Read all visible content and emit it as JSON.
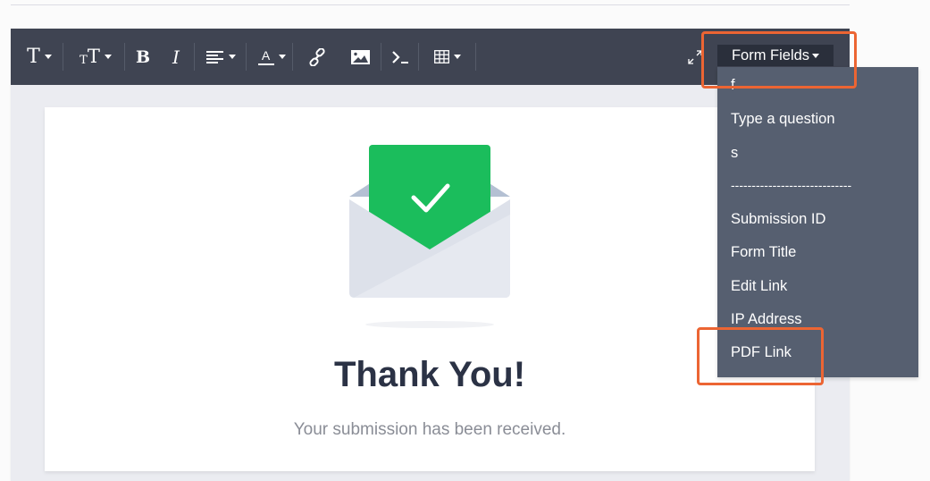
{
  "toolbar": {
    "buttons": [
      {
        "name": "font-family",
        "glyph": "T",
        "has_caret": true
      },
      {
        "name": "font-size",
        "glyph": "TT",
        "has_caret": true
      },
      {
        "name": "bold",
        "glyph": "B",
        "has_caret": false
      },
      {
        "name": "italic",
        "glyph": "I",
        "has_caret": false
      },
      {
        "name": "align",
        "icon": "align-left-icon",
        "has_caret": true
      },
      {
        "name": "text-color",
        "glyph": "A",
        "has_caret": true
      },
      {
        "name": "link",
        "icon": "link-icon",
        "has_caret": false
      },
      {
        "name": "image",
        "icon": "image-icon",
        "has_caret": false
      },
      {
        "name": "code",
        "icon": "terminal-icon",
        "has_caret": false
      },
      {
        "name": "table",
        "icon": "table-icon",
        "has_caret": true
      },
      {
        "name": "fullscreen",
        "icon": "expand-icon",
        "has_caret": false
      }
    ],
    "glyph_font": "T",
    "glyph_size_small": "T",
    "glyph_size_big": "T",
    "glyph_bold": "B",
    "glyph_italic": "I",
    "glyph_color": "A",
    "form_fields_label": "Form Fields"
  },
  "dropdown": {
    "items": [
      "f",
      "Type a question",
      "s",
      "-----------------------------",
      "Submission ID",
      "Form Title",
      "Edit Link",
      "IP Address",
      "PDF Link"
    ]
  },
  "content": {
    "title": "Thank You!",
    "subtitle": "Your submission has been received."
  },
  "colors": {
    "toolbar_bg": "#3f4452",
    "dropdown_bg": "#565f70",
    "highlight": "#ec6533",
    "success_green": "#1bbd5c",
    "title_color": "#2b3245"
  }
}
